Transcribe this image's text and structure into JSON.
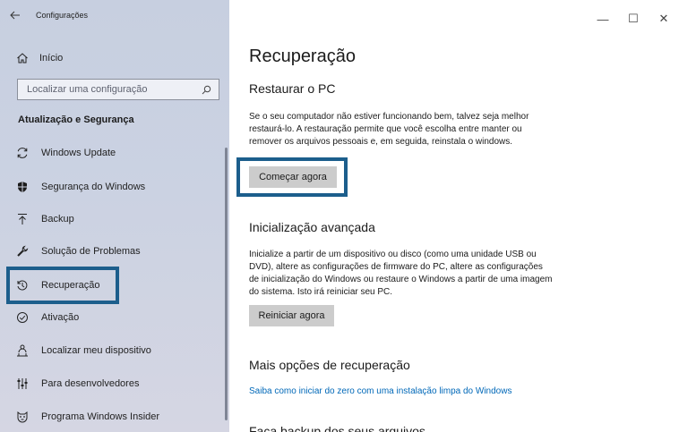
{
  "window": {
    "title": "Configurações",
    "controls": {
      "minimize": "—",
      "maximize": "☐",
      "close": "✕"
    }
  },
  "sidebar": {
    "back_icon": "arrow-left-icon",
    "home_label": "Início",
    "search_placeholder": "Localizar uma configuração",
    "section_title": "Atualização e Segurança",
    "items": [
      {
        "label": "Windows Update",
        "icon": "sync-icon"
      },
      {
        "label": "Segurança do Windows",
        "icon": "shield-icon"
      },
      {
        "label": "Backup",
        "icon": "backup-arrow-icon"
      },
      {
        "label": "Solução de Problemas",
        "icon": "wrench-icon"
      },
      {
        "label": "Recuperação",
        "icon": "history-icon",
        "selected": true
      },
      {
        "label": "Ativação",
        "icon": "check-circle-icon"
      },
      {
        "label": "Localizar meu dispositivo",
        "icon": "person-pin-icon"
      },
      {
        "label": "Para desenvolvedores",
        "icon": "dev-tools-icon"
      },
      {
        "label": "Programa Windows Insider",
        "icon": "insider-cat-icon"
      }
    ]
  },
  "main": {
    "title": "Recuperação",
    "reset": {
      "heading": "Restaurar o PC",
      "text": "Se o seu computador não estiver funcionando bem, talvez seja melhor restaurá-lo. A restauração permite que você escolha entre manter ou remover os arquivos pessoais e, em seguida, reinstala o windows.",
      "button": "Começar agora"
    },
    "advanced": {
      "heading": "Inicialização avançada",
      "text": "Inicialize a partir de um dispositivo ou disco (como uma unidade USB ou DVD), altere as configurações de firmware do PC, altere as configurações de inicialização do Windows ou restaure o Windows a partir de uma imagem do sistema. Isto irá reiniciar seu PC.",
      "button": "Reiniciar agora"
    },
    "more": {
      "heading": "Mais opções de recuperação",
      "link": "Saiba como iniciar do zero com uma instalação limpa do Windows"
    },
    "backup_heading": "Faça backup dos seus arquivos"
  },
  "colors": {
    "highlight_border": "#1c5e8c",
    "link": "#0068b8",
    "button_bg": "#cccccc"
  }
}
